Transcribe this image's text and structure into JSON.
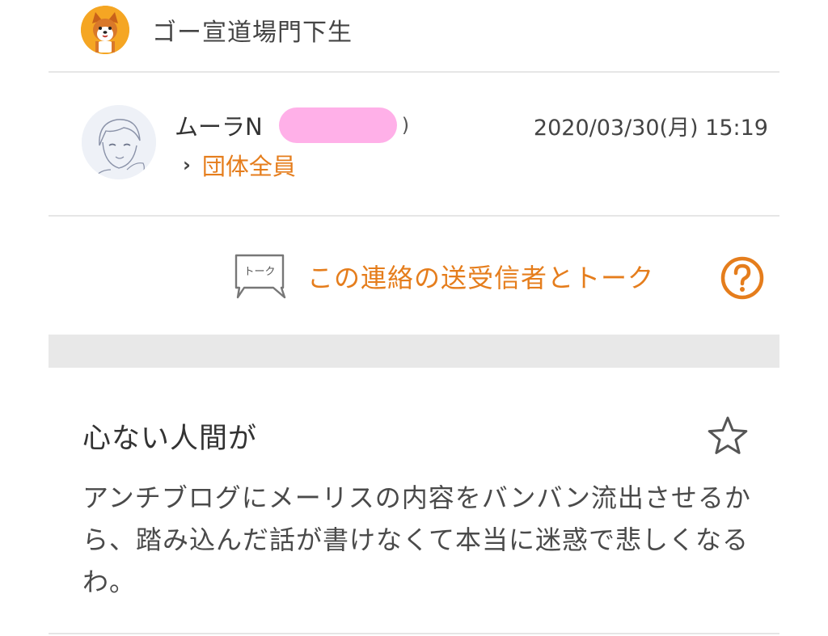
{
  "group": {
    "name": "ゴー宣道場門下生",
    "avatar_icon": "shiba-dog-icon"
  },
  "message_header": {
    "sender_name": "ムーラN",
    "sender_name_tail": ")",
    "timestamp": "2020/03/30(月) 15:19",
    "recipient_label": "団体全員",
    "recipient_chevron": "›"
  },
  "talk": {
    "link_label": "この連絡の送受信者とトーク",
    "icon_text": "トーク"
  },
  "message": {
    "title": "心ない人間が",
    "body": "アンチブログにメーリスの内容をバンバン流出させるから、踏み込んだ話が書けなくて本当に迷惑で悲しくなるわ。"
  },
  "colors": {
    "accent": "#e57d1c",
    "redaction": "#ffb0e8",
    "divider": "#e6e6e6",
    "band": "#e8e8e8"
  }
}
